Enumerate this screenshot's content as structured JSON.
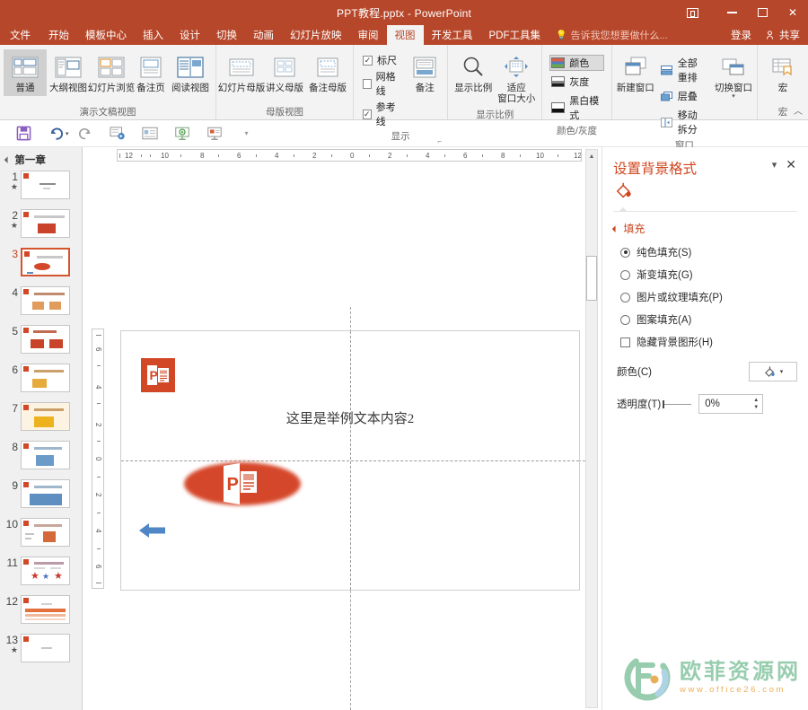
{
  "titlebar": {
    "document_title": "PPT教程.pptx - PowerPoint",
    "ribbon_display_options": "ribbon-display-options",
    "minimize": "minimize",
    "maximize": "restore",
    "close": "close"
  },
  "tabs": [
    {
      "label": "文件",
      "active": false
    },
    {
      "label": "开始",
      "active": false
    },
    {
      "label": "模板中心",
      "active": false
    },
    {
      "label": "插入",
      "active": false
    },
    {
      "label": "设计",
      "active": false
    },
    {
      "label": "切换",
      "active": false
    },
    {
      "label": "动画",
      "active": false
    },
    {
      "label": "幻灯片放映",
      "active": false
    },
    {
      "label": "审阅",
      "active": false
    },
    {
      "label": "视图",
      "active": true
    },
    {
      "label": "开发工具",
      "active": false
    },
    {
      "label": "PDF工具集",
      "active": false
    }
  ],
  "tellme": {
    "placeholder": "告诉我您想要做什么..."
  },
  "account": {
    "signin": "登录",
    "share": "共享"
  },
  "ribbon": {
    "groups": [
      {
        "label": "演示文稿视图",
        "buttons": [
          {
            "label": "普通",
            "selected": true
          },
          {
            "label": "大纲视图",
            "selected": false
          },
          {
            "label": "幻灯片浏览",
            "selected": false
          },
          {
            "label": "备注页",
            "selected": false
          },
          {
            "label": "阅读视图",
            "selected": false
          }
        ]
      },
      {
        "label": "母版视图",
        "buttons": [
          {
            "label": "幻灯片母版",
            "selected": false
          },
          {
            "label": "讲义母版",
            "selected": false
          },
          {
            "label": "备注母版",
            "selected": false
          }
        ]
      },
      {
        "label": "显示",
        "has_dialog_launcher": true,
        "checkboxes": [
          {
            "label": "标尺",
            "checked": true
          },
          {
            "label": "网格线",
            "checked": false
          },
          {
            "label": "参考线",
            "checked": true
          }
        ],
        "buttons": [
          {
            "label": "备注",
            "selected": false
          }
        ]
      },
      {
        "label": "显示比例",
        "buttons": [
          {
            "label": "显示比例",
            "selected": false
          },
          {
            "label": "适应\n窗口大小",
            "line1": "适应",
            "line2": "窗口大小",
            "selected": false
          }
        ]
      },
      {
        "label": "颜色/灰度",
        "items": [
          {
            "label": "颜色",
            "selected": true,
            "swatch": "color-swatch"
          },
          {
            "label": "灰度",
            "selected": false,
            "swatch": "gray-swatch"
          },
          {
            "label": "黑白模式",
            "selected": false,
            "swatch": "bw-swatch"
          }
        ]
      },
      {
        "label": "窗口",
        "buttons": [
          {
            "label": "新建窗口",
            "selected": false
          }
        ],
        "items": [
          {
            "label": "全部重排"
          },
          {
            "label": "层叠"
          },
          {
            "label": "移动拆分"
          }
        ],
        "buttons2": [
          {
            "label": "切换窗口",
            "has_caret": true
          }
        ]
      },
      {
        "label": "宏",
        "buttons": [
          {
            "label": "宏",
            "selected": false
          }
        ]
      }
    ],
    "collapse_ribbon": "collapse-ribbon"
  },
  "qat": {
    "buttons": [
      {
        "name": "save-button",
        "icon": "save-icon"
      },
      {
        "name": "undo-button",
        "icon": "undo-icon",
        "has_caret": true
      },
      {
        "name": "redo-button",
        "icon": "redo-icon"
      },
      {
        "name": "start-from-beginning-button",
        "icon": "slideshow-icon"
      },
      {
        "name": "new-slide-button",
        "icon": "new-slide-icon"
      },
      {
        "name": "present-button",
        "icon": "present-icon"
      },
      {
        "name": "custom-show-button",
        "icon": "custom-show-icon"
      },
      {
        "name": "customize-qat-button",
        "icon": "chevron-down-icon"
      }
    ]
  },
  "thumbnails": {
    "section_title": "第一章",
    "slides": [
      {
        "num": "1",
        "star": true,
        "active": false,
        "style": "title"
      },
      {
        "num": "2",
        "star": true,
        "active": false,
        "style": "logo-red"
      },
      {
        "num": "3",
        "star": false,
        "active": true,
        "style": "ellipse-red"
      },
      {
        "num": "4",
        "star": false,
        "active": false,
        "style": "two-orange"
      },
      {
        "num": "5",
        "star": false,
        "active": false,
        "style": "two-red"
      },
      {
        "num": "6",
        "star": false,
        "active": false,
        "style": "one-yellow"
      },
      {
        "num": "7",
        "star": false,
        "active": false,
        "style": "yellow-band"
      },
      {
        "num": "8",
        "star": false,
        "active": false,
        "style": "blue-box"
      },
      {
        "num": "9",
        "star": false,
        "active": false,
        "style": "blue-wide"
      },
      {
        "num": "10",
        "star": false,
        "active": false,
        "style": "orange-small"
      },
      {
        "num": "11",
        "star": false,
        "active": false,
        "style": "three-stars"
      },
      {
        "num": "12",
        "star": false,
        "active": false,
        "style": "orange-bars"
      },
      {
        "num": "13",
        "star": true,
        "active": false,
        "style": "blank"
      }
    ]
  },
  "ruler": {
    "horizontal_labels": [
      "12",
      "10",
      "8",
      "6",
      "4",
      "2",
      "0",
      "2",
      "4",
      "6",
      "8",
      "10",
      "12"
    ],
    "vertical_labels": [
      "6",
      "4",
      "2",
      "0",
      "2",
      "4",
      "6"
    ],
    "unit_note": ""
  },
  "slide": {
    "body_text": "这里是举例文本内容2",
    "shapes": [
      {
        "name": "powerpoint-logo-small",
        "type": "image"
      },
      {
        "name": "powerpoint-logo-ellipse",
        "type": "image"
      },
      {
        "name": "blue-left-arrow",
        "type": "shape",
        "color": "#4f86c6"
      }
    ]
  },
  "format_pane": {
    "title": "设置背景格式",
    "collapse_label": "pane-options",
    "close_label": "close-pane",
    "icon_name": "fill-bucket-icon",
    "fill_group": {
      "label": "填充",
      "options": [
        {
          "label": "纯色填充(S)",
          "selected": true
        },
        {
          "label": "渐变填充(G)",
          "selected": false
        },
        {
          "label": "图片或纹理填充(P)",
          "selected": false
        },
        {
          "label": "图案填充(A)",
          "selected": false
        }
      ],
      "hide_bg_graphics": {
        "label": "隐藏背景图形(H)",
        "checked": false
      },
      "color": {
        "label": "颜色(C)",
        "value": "#ffffff"
      },
      "transparency": {
        "label": "透明度(T)",
        "value": "0%",
        "slider_position": 0
      }
    }
  },
  "watermark": {
    "chinese": "欧菲资源网",
    "url": "www.office26.com"
  },
  "colors": {
    "brand": "#b7472a",
    "ribbon_bg": "#f3f3f3",
    "accent_orange": "#d0451f",
    "pp_red": "#d24726",
    "arrow_blue": "#4f86c6"
  }
}
